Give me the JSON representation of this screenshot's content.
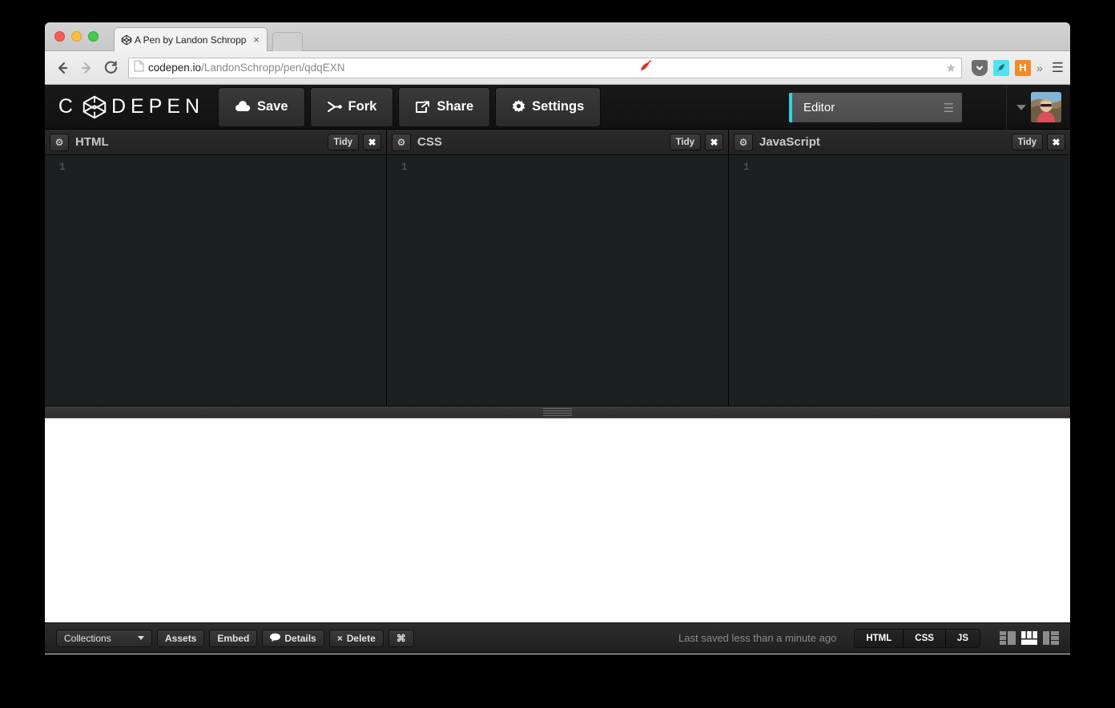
{
  "browser": {
    "tab": {
      "title": "A Pen by Landon Schropp",
      "close": "×",
      "favicon_name": "codepen-favicon"
    },
    "new_tab_label": "",
    "nav": {
      "back": "←",
      "forward": "→",
      "reload": "⟳"
    },
    "omnibox": {
      "domain": "codepen.io",
      "path": "/LandonSchropp/pen/qdqEXN",
      "star": "★",
      "page_icon": "page-icon"
    },
    "extensions": [
      {
        "name": "pepper-extension-icon",
        "label": ""
      },
      {
        "name": "pocket-extension-icon",
        "label": "▼"
      },
      {
        "name": "rocket-extension-icon",
        "label": "➤"
      },
      {
        "name": "honey-extension-icon",
        "label": "H"
      },
      {
        "name": "overflow-chevrons-icon",
        "label": "»"
      },
      {
        "name": "browser-menu-icon",
        "label": "☰"
      }
    ]
  },
  "app": {
    "logo": {
      "before": "C",
      "after": "DEPEN"
    },
    "toolbar": [
      {
        "label": "Save",
        "icon": "cloud-icon"
      },
      {
        "label": "Fork",
        "icon": "fork-icon"
      },
      {
        "label": "Share",
        "icon": "share-icon"
      },
      {
        "label": "Settings",
        "icon": "gear-icon"
      }
    ],
    "view_select": {
      "label": "Editor",
      "menu_icon": "☰",
      "accent_color": "#2fd2e0"
    },
    "user": {
      "caret": "caret-down-icon",
      "avatar_name": "user-avatar"
    }
  },
  "panes": [
    {
      "title": "HTML",
      "gear": "⚙",
      "tidy": "Tidy",
      "close": "✖",
      "line_number": "1",
      "content": ""
    },
    {
      "title": "CSS",
      "gear": "⚙",
      "tidy": "Tidy",
      "close": "✖",
      "line_number": "1",
      "content": ""
    },
    {
      "title": "JavaScript",
      "gear": "⚙",
      "tidy": "Tidy",
      "close": "✖",
      "line_number": "1",
      "content": ""
    }
  ],
  "bottom": {
    "collections": {
      "label": "Collections",
      "caret": "caret-down-icon"
    },
    "assets": "Assets",
    "embed": "Embed",
    "details": {
      "label": "Details",
      "icon": "💬"
    },
    "delete": {
      "label": "Delete",
      "icon": "×"
    },
    "command": "⌘",
    "saved_status": "Last saved less than a minute ago",
    "segments": [
      "HTML",
      "CSS",
      "JS"
    ],
    "layouts": [
      {
        "name": "layout-left-icon",
        "active": false
      },
      {
        "name": "layout-columns-icon",
        "active": true
      },
      {
        "name": "layout-right-icon",
        "active": false
      }
    ]
  }
}
